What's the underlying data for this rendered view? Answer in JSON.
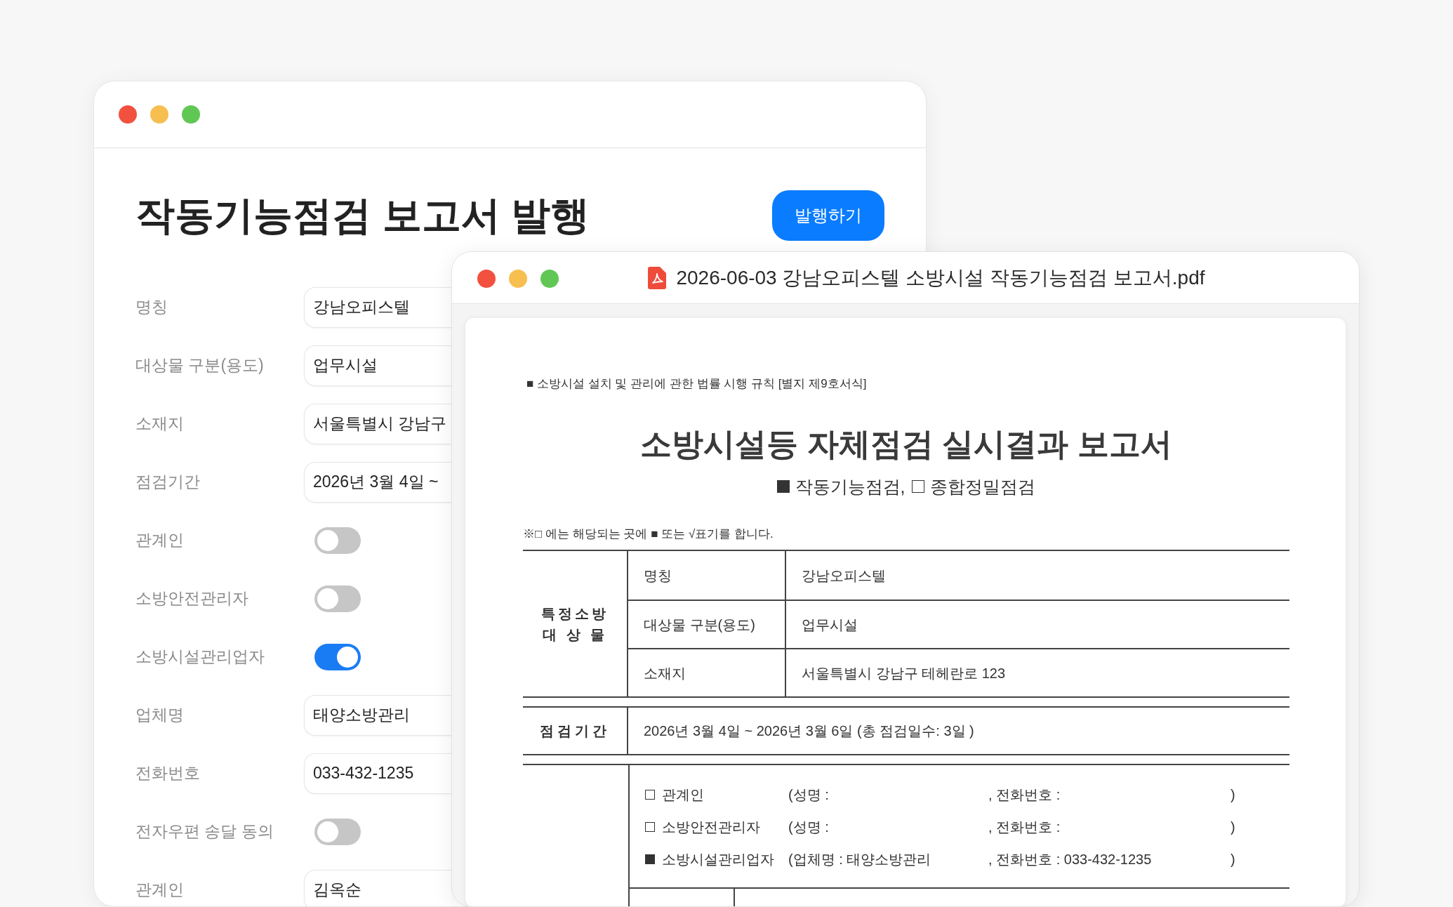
{
  "back_window": {
    "title": "작동기능점검 보고서 발행",
    "publish_button": "발행하기",
    "fields": [
      {
        "label": "명칭",
        "kind": "input",
        "value": "강남오피스텔"
      },
      {
        "label": "대상물 구분(용도)",
        "kind": "input",
        "value": "업무시설"
      },
      {
        "label": "소재지",
        "kind": "input",
        "value": "서울특별시 강남구"
      },
      {
        "label": "점검기간",
        "kind": "input",
        "value": "2026년 3월 4일 ~"
      },
      {
        "label": "관계인",
        "kind": "toggle",
        "on": false
      },
      {
        "label": "소방안전관리자",
        "kind": "toggle",
        "on": false
      },
      {
        "label": "소방시설관리업자",
        "kind": "toggle",
        "on": true
      },
      {
        "label": "업체명",
        "kind": "input",
        "value": "태양소방관리"
      },
      {
        "label": "전화번호",
        "kind": "input",
        "value": "033-432-1235"
      },
      {
        "label": "전자우편 송달 동의",
        "kind": "toggle",
        "on": false
      },
      {
        "label": "관계인",
        "kind": "input",
        "value": "김옥순"
      }
    ]
  },
  "pdf_window": {
    "title": "2026-06-03 강남오피스텔 소방시설 작동기능점검 보고서.pdf",
    "document": {
      "header_note": "■ 소방시설 설치 및 관리에 관한 법률 시행 규칙 [별지 제9호서식]",
      "title": "소방시설등 자체점검 실시결과 보고서",
      "inspection_types": [
        {
          "label": "작동기능점검,",
          "checked": true
        },
        {
          "label": "종합정밀점검",
          "checked": false
        }
      ],
      "note": "※□ 에는 해당되는 곳에 ■ 또는 √표기를 합니다.",
      "target": {
        "heading": "특정소방\n대 상 물",
        "rows": [
          {
            "label": "명칭",
            "value": "강남오피스텔"
          },
          {
            "label": "대상물 구분(용도)",
            "value": "업무시설"
          },
          {
            "label": "소재지",
            "value": "서울특별시 강남구 테헤란로 123"
          }
        ]
      },
      "period": {
        "heading": "점검기간",
        "value": "2026년 3월 4일 ~ 2026년 3월 6일 (총 점검일수: 3일 )"
      },
      "contacts": [
        {
          "checked": false,
          "role": "관계인",
          "name_part": "(성명 :",
          "phone_part": ", 전화번호 :",
          "close": ")"
        },
        {
          "checked": false,
          "role": "소방안전관리자",
          "name_part": "(성명 :",
          "phone_part": ", 전화번호 :",
          "close": ")"
        },
        {
          "checked": true,
          "role": "소방시설관리업자",
          "name_part": "(업체명 : 태양소방관리",
          "phone_part": ", 전화번호 : 033-432-1235",
          "close": ")"
        }
      ]
    }
  }
}
